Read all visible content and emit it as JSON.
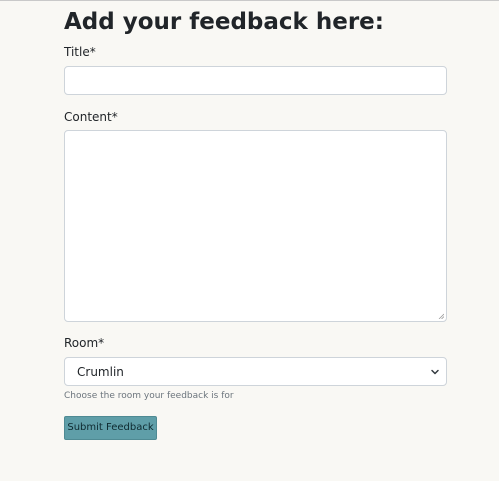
{
  "form": {
    "heading": "Add your feedback here:",
    "title_label": "Title*",
    "title_value": "",
    "content_label": "Content*",
    "content_value": "",
    "room_label": "Room*",
    "room_selected": "Crumlin",
    "room_help": "Choose the room your feedback is for",
    "submit_label": "Submit Feedback"
  },
  "icons": {
    "select_arrow": "chevron-down-icon",
    "resize": "resize-grip-icon"
  },
  "colors": {
    "page_background": "#f9f8f4",
    "button_background": "#5f9ea8",
    "input_border": "#ced4da",
    "help_text": "#6c757d"
  }
}
